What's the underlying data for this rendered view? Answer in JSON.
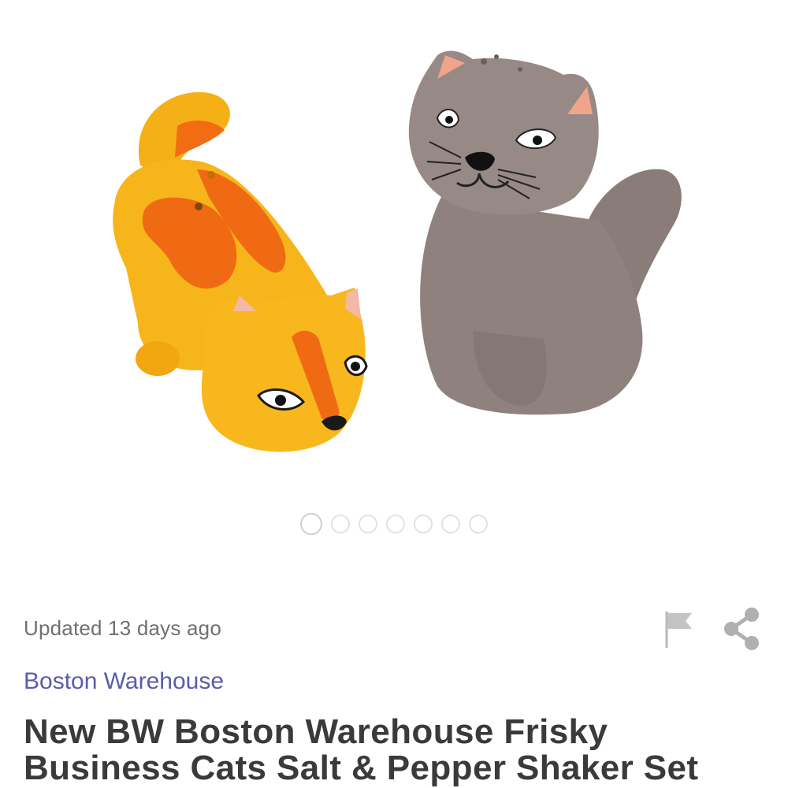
{
  "gallery": {
    "image_count": 7,
    "active_index": 0
  },
  "listing": {
    "updated_text": "Updated 13 days ago",
    "brand": "Boston Warehouse",
    "title": "New BW Boston Warehouse Frisky Business Cats Salt & Pepper Shaker Set"
  },
  "actions": {
    "flag_icon": "flag-icon",
    "share_icon": "share-icon"
  },
  "colors": {
    "brand": "#5a5ca8",
    "text_muted": "#707070",
    "title": "#3a3a3a"
  }
}
